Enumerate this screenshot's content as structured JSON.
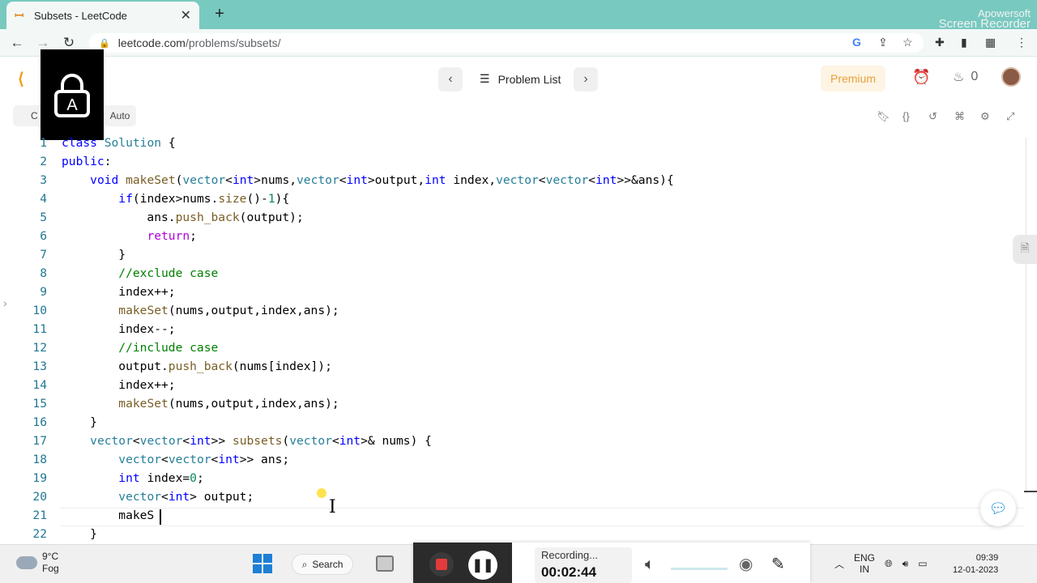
{
  "browser": {
    "tab_title": "Subsets - LeetCode",
    "url_host": "leetcode.com",
    "url_path": "/problems/subsets/"
  },
  "watermark": {
    "line1": "Apowersoft",
    "line2": "Screen Recorder"
  },
  "header": {
    "problem_list_label": "Problem List",
    "premium_label": "Premium",
    "streak_count": "0"
  },
  "editor_toolbar": {
    "lang_label": "C",
    "auto_label": "Auto"
  },
  "code_lines": [
    "class Solution {",
    "public:",
    "    void makeSet(vector<int>nums,vector<int>output,int index,vector<vector<int>>&ans){",
    "        if(index>nums.size()-1){",
    "            ans.push_back(output);",
    "            return;",
    "        }",
    "        //exclude case",
    "        index++;",
    "        makeSet(nums,output,index,ans);",
    "        index--;",
    "        //include case",
    "        output.push_back(nums[index]);",
    "        index++;",
    "        makeSet(nums,output,index,ans);",
    "    }",
    "    vector<vector<int>> subsets(vector<int>& nums) {",
    "        vector<vector<int>> ans;",
    "        int index=0;",
    "        vector<int> output;",
    "        makeS",
    "    }"
  ],
  "taskbar": {
    "weather_temp": "9°C",
    "weather_desc": "Fog",
    "search_label": "Search",
    "lang_top": "ENG",
    "lang_bottom": "IN",
    "time": "09:39",
    "date": "12-01-2023"
  },
  "recorder": {
    "status_label": "Recording...",
    "elapsed": "00:02:44"
  },
  "colors": {
    "accent": "#78c9c0",
    "premium": "#e8a13a",
    "record": "#e33b3b"
  }
}
